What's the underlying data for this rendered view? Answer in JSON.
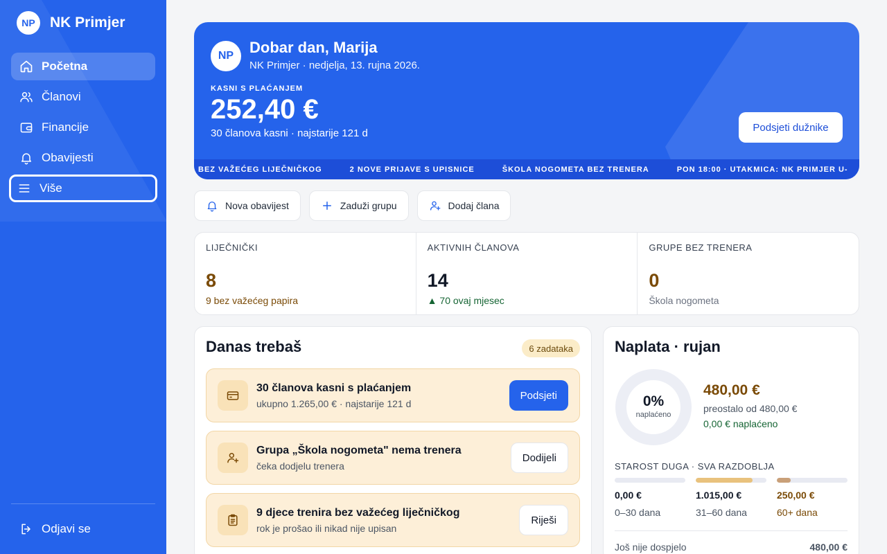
{
  "sidebar": {
    "logo_initials": "NP",
    "brand": "NK Primjer",
    "items": [
      {
        "label": "Početna",
        "icon": "home-icon",
        "active": true
      },
      {
        "label": "Članovi",
        "icon": "users-icon"
      },
      {
        "label": "Financije",
        "icon": "wallet-icon"
      },
      {
        "label": "Obavijesti",
        "icon": "bell-icon"
      },
      {
        "label": "Više",
        "icon": "menu-icon",
        "focused": true
      }
    ],
    "logout_label": "Odjavi se"
  },
  "hero": {
    "logo_initials": "NP",
    "greeting": "Dobar dan, Marija",
    "subtitle": "NK Primjer · nedjelja, 13. rujna 2026.",
    "late_label": "KASNI S PLAĆANJEM",
    "late_amount": "252,40 €",
    "late_sub": "30 članova kasni · najstarije 121 d",
    "remind_button": "Podsjeti dužnike",
    "ticker": [
      "BEZ VAŽEĆEG LIJEČNIČKOG",
      "2 NOVE PRIJAVE S UPISNICE",
      "ŠKOLA NOGOMETA BEZ TRENERA",
      "PON 18:00 · UTAKMICA: NK PRIMJER U-"
    ]
  },
  "actions": {
    "new_notice": "Nova obavijest",
    "charge_group": "Zaduži grupu",
    "add_member": "Dodaj člana"
  },
  "stats": [
    {
      "label": "LIJEČNIČKI",
      "value": "8",
      "sub": "9 bez važećeg papira",
      "tone": "warn"
    },
    {
      "label": "AKTIVNIH ČLANOVA",
      "value": "14",
      "sub": "▲ 70 ovaj mjesec",
      "tone": "good"
    },
    {
      "label": "GRUPE BEZ TRENERA",
      "value": "0",
      "sub": "Škola nogometa",
      "tone": "warn-muted"
    }
  ],
  "tasks": {
    "title": "Danas trebaš",
    "badge": "6 zadataka",
    "items": [
      {
        "title": "30 članova kasni s plaćanjem",
        "sub": "ukupno 1.265,00 € · najstarije 121 d",
        "button": "Podsjeti",
        "icon": "card-icon"
      },
      {
        "title": "Grupa „Škola nogometa\" nema trenera",
        "sub": "čeka dodjelu trenera",
        "button": "Dodijeli",
        "icon": "user-plus-icon"
      },
      {
        "title": "9 djece trenira bez važećeg liječničkog",
        "sub": "rok je prošao ili nikad nije upisan",
        "button": "Riješi",
        "icon": "clipboard-icon"
      }
    ]
  },
  "billing": {
    "title": "Naplata · rujan",
    "percent_text": "0%",
    "percent_label": "naplaćeno",
    "collected_fraction": 0,
    "remaining_amount": "480,00 €",
    "remaining_text": "preostalo od 480,00 €",
    "collected_text": "0,00 € naplaćeno",
    "aging_label": "STAROST DUGA · SVA RAZDOBLJA",
    "buckets": [
      {
        "amount": "0,00 €",
        "range": "0–30 dana",
        "fraction": 0,
        "color": "#e8eaf2"
      },
      {
        "amount": "1.015,00 €",
        "range": "31–60 dana",
        "fraction": 0.8,
        "color": "#e9c27d"
      },
      {
        "amount": "250,00 €",
        "range": "60+ dana",
        "fraction": 0.2,
        "color": "#c9a079"
      }
    ],
    "footer_label": "Još nije dospjelo",
    "footer_amount": "480,00 €"
  },
  "colors": {
    "primary": "#2563eb",
    "warn_text": "#7a4a06",
    "good_text": "#166534"
  }
}
